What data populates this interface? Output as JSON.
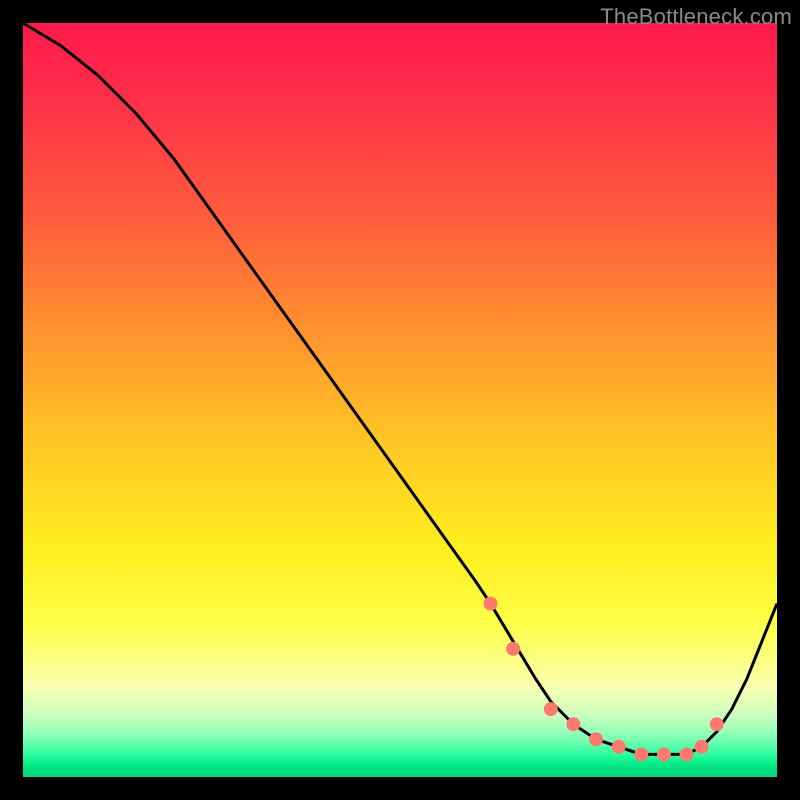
{
  "watermark": "TheBottleneck.com",
  "chart_data": {
    "type": "line",
    "title": "",
    "xlabel": "",
    "ylabel": "",
    "xlim": [
      0,
      100
    ],
    "ylim": [
      0,
      100
    ],
    "grid": false,
    "legend": false,
    "curve_note": "Black bottleneck curve; y is approximate percent (0=bottom/green, 100=top/red). Values estimated from pixels.",
    "x": [
      0,
      5,
      10,
      15,
      20,
      25,
      30,
      35,
      40,
      45,
      50,
      55,
      60,
      62,
      65,
      68,
      70,
      73,
      76,
      79,
      82,
      85,
      88,
      90,
      92,
      94,
      96,
      98,
      100
    ],
    "y": [
      100,
      97,
      93,
      88,
      82,
      75,
      68,
      61,
      54,
      47,
      40,
      33,
      26,
      23,
      18,
      13,
      10,
      7,
      5,
      4,
      3,
      3,
      3,
      4,
      6,
      9,
      13,
      18,
      23
    ],
    "markers_note": "Salmon dot markers along the valley of the curve",
    "marker_x": [
      62,
      65,
      70,
      73,
      76,
      79,
      82,
      85,
      88,
      90,
      92
    ],
    "marker_y": [
      23,
      17,
      9,
      7,
      5,
      4,
      3,
      3,
      3,
      4,
      7
    ],
    "marker_color": "#ff7a6e",
    "curve_color": "#000000"
  }
}
